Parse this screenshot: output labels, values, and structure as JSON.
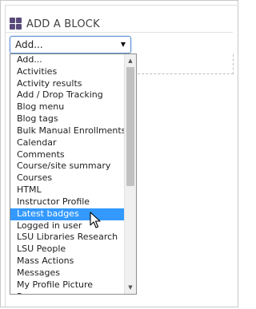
{
  "header": {
    "title": "ADD A BLOCK",
    "icon": "blocks-grid-icon",
    "icon_color": "#594a7b"
  },
  "select": {
    "value": "Add...",
    "arrow": "▼"
  },
  "dropdown": {
    "items": [
      "Add...",
      "Activities",
      "Activity results",
      "Add / Drop Tracking",
      "Blog menu",
      "Blog tags",
      "Bulk Manual Enrollments",
      "Calendar",
      "Comments",
      "Course/site summary",
      "Courses",
      "HTML",
      "Instructor Profile",
      "Latest badges",
      "Logged in user",
      "LSU Libraries Research",
      "LSU People",
      "Mass Actions",
      "Messages",
      "My Profile Picture",
      "P..."
    ],
    "highlighted": "Latest badges",
    "highlight_color": "#3399ff",
    "scroll_position": 0.0,
    "visible_fraction": 0.55
  },
  "scrollbar": {
    "up_arrow": "▲",
    "down_arrow": "▼"
  }
}
